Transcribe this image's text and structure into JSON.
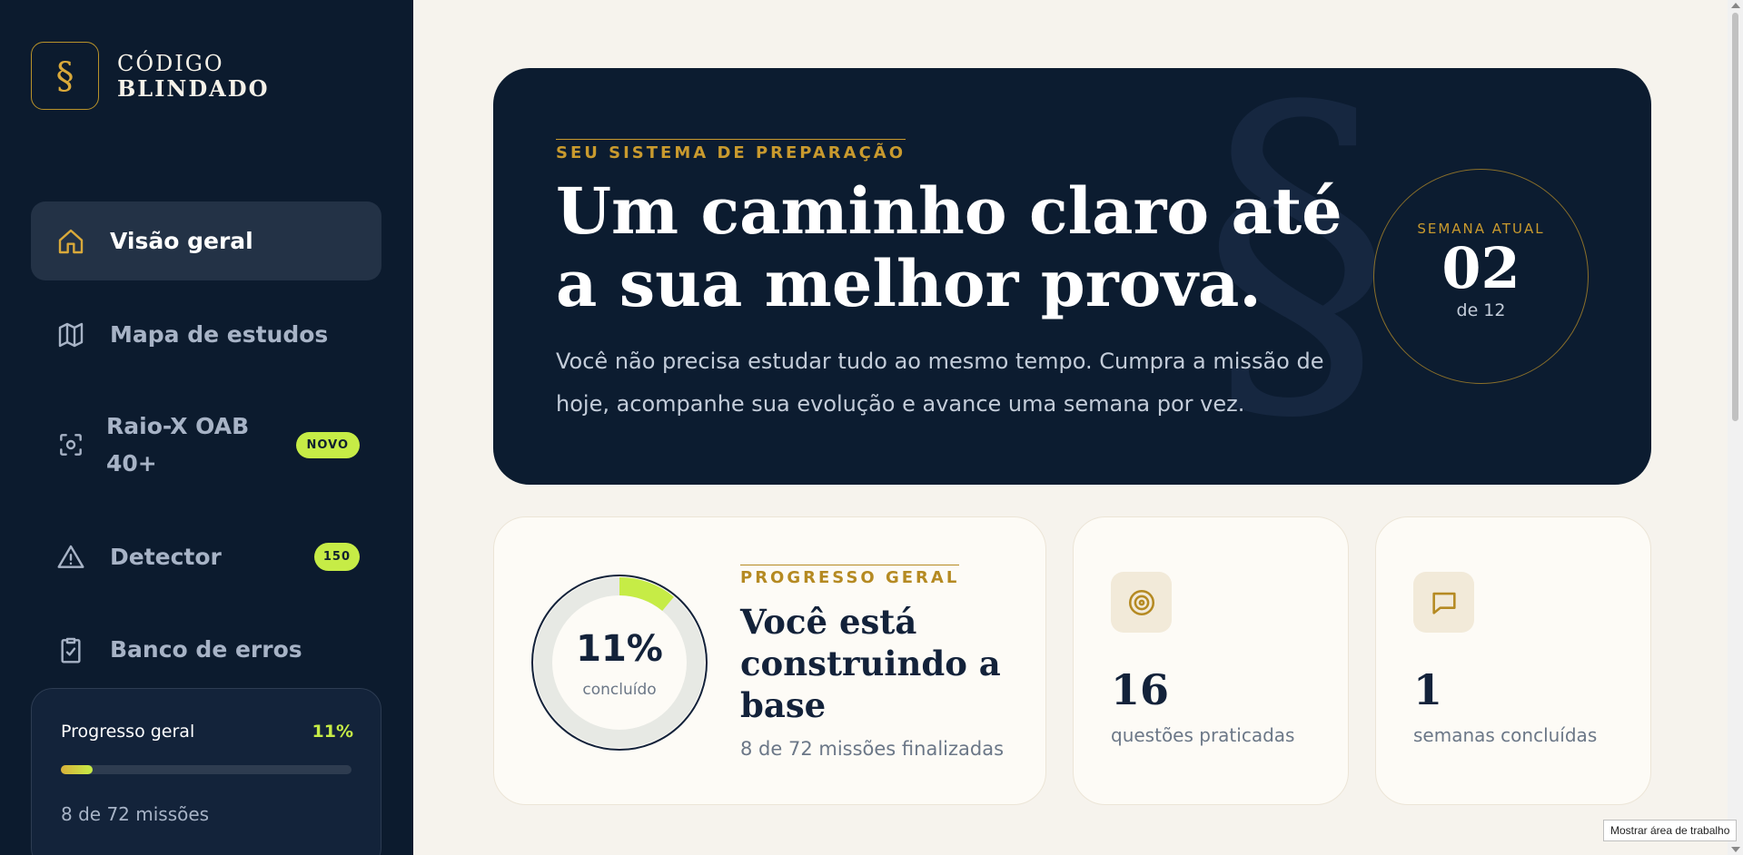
{
  "brand": {
    "mark": "§",
    "line1": "CÓDIGO",
    "line2": "BLINDADO"
  },
  "nav": [
    {
      "label": "Visão geral",
      "icon": "home-icon",
      "active": true
    },
    {
      "label": "Mapa de estudos",
      "icon": "map-icon"
    },
    {
      "label": "Raio-X OAB 40+",
      "label_line1": "Raio-X OAB",
      "label_line2": "40+",
      "icon": "scan-icon",
      "badge": "NOVO"
    },
    {
      "label": "Detector",
      "icon": "warning-icon",
      "badge": "150"
    },
    {
      "label": "Banco de erros",
      "icon": "clipboard-check-icon"
    }
  ],
  "sidebar_progress": {
    "label": "Progresso geral",
    "percent_text": "11%",
    "fraction": 0.11,
    "sub": "8 de 72 missões"
  },
  "hero": {
    "eyebrow": "SEU SISTEMA DE PREPARAÇÃO",
    "title_line1": "Um caminho claro até",
    "title_line2": "a sua melhor prova.",
    "description": "Você não precisa estudar tudo ao mesmo tempo. Cumpra a missão de hoje, acompanhe sua evolução e avance uma semana por vez.",
    "bg_mark": "§",
    "week": {
      "label": "SEMANA ATUAL",
      "number": "02",
      "of": "de 12"
    }
  },
  "progress_card": {
    "percent_text": "11%",
    "fraction": 0.11,
    "ring_sub": "concluído",
    "eyebrow": "PROGRESSO GERAL",
    "title": "Você está construindo a base",
    "sub": "8 de 72 missões finalizadas"
  },
  "stats": [
    {
      "icon": "target-icon",
      "value": "16",
      "label": "questões praticadas"
    },
    {
      "icon": "message-icon",
      "value": "1",
      "label": "semanas concluídas"
    }
  ],
  "tooltip": "Mostrar área de trabalho",
  "colors": {
    "navy": "#0c1b2e",
    "gold": "#c99a2e",
    "lime": "#c6ec46",
    "cream": "#f6f3ed"
  }
}
